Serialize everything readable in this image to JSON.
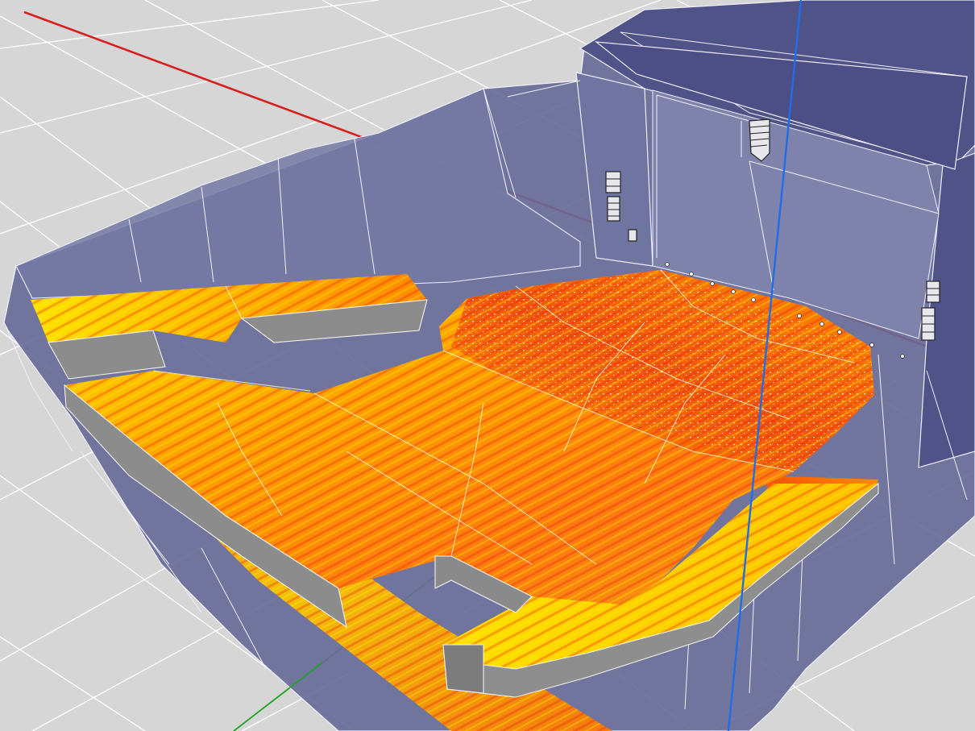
{
  "viewport": {
    "background": "#d6d6d6",
    "grid_color": "#ffffff",
    "axes": {
      "x_color": "#d81e1e",
      "y_color": "#1fa31f",
      "z_color": "#1f6ee8"
    }
  },
  "scene": {
    "room_fill": "#5c5f8f",
    "room_edge": "#eeeeff",
    "balcony_front": "#8a8a8a",
    "heatmap_colors": [
      "#fff200",
      "#ffb300",
      "#ff8000",
      "#f04a10"
    ],
    "loudspeakers": [
      {
        "name": "main-line-array",
        "icon": "line-array-icon"
      },
      {
        "name": "left-stack",
        "icon": "line-array-icon"
      },
      {
        "name": "left-sub",
        "icon": "speaker-icon"
      },
      {
        "name": "right-stack",
        "icon": "line-array-icon"
      }
    ]
  }
}
